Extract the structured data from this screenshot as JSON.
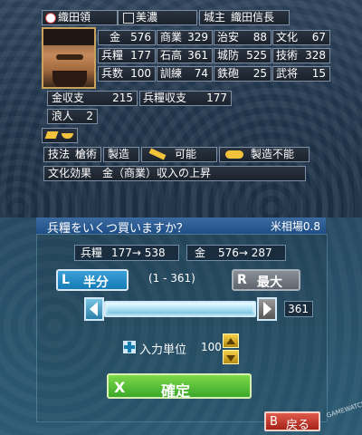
{
  "top": {
    "fief": "織田領",
    "province": "美濃",
    "lord_label": "城主",
    "lord_name": "織田信長",
    "stats": [
      {
        "label": "金",
        "value": "576"
      },
      {
        "label": "商業",
        "value": "329"
      },
      {
        "label": "治安",
        "value": "88"
      },
      {
        "label": "文化",
        "value": "67"
      },
      {
        "label": "兵糧",
        "value": "177"
      },
      {
        "label": "石高",
        "value": "361"
      },
      {
        "label": "城防",
        "value": "525"
      },
      {
        "label": "技術",
        "value": "328"
      },
      {
        "label": "兵数",
        "value": "100"
      },
      {
        "label": "訓練",
        "value": "74"
      },
      {
        "label": "鉄砲",
        "value": "25"
      },
      {
        "label": "武将",
        "value": "15"
      }
    ],
    "gold_income_label": "金収支",
    "gold_income": "215",
    "food_income_label": "兵糧収支",
    "food_income": "177",
    "ronin_label": "浪人",
    "ronin": "2",
    "skill_label": "技法",
    "skill_value": "槍術",
    "produce_label": "製造",
    "produce_can": "可能",
    "produce_cannot": "製造不能",
    "culture_label": "文化効果",
    "culture_value": "金（商業）収入の上昇"
  },
  "bottom": {
    "question": "兵糧をいくつ買いますか？",
    "rice_rate": "米相場0.8",
    "food_label": "兵糧",
    "food_change": "177→ 538",
    "gold_label": "金",
    "gold_change": "576→ 287",
    "half_key": "L",
    "half_label": "半分",
    "range": "(1 - 361)",
    "max_key": "R",
    "max_label": "最大",
    "amount": "361",
    "amount_fraction": 1.0,
    "unit_label": "入力単位",
    "unit_value": "100",
    "confirm_key": "X",
    "confirm_label": "確定",
    "back_key": "B",
    "back_label": "戻る",
    "watermark": "GAMEWATCH"
  },
  "colors": {
    "accent_green": "#3aa82a",
    "accent_blue": "#147bb5",
    "back_red": "#c0302a",
    "icon_gold": "#f2c23b"
  }
}
